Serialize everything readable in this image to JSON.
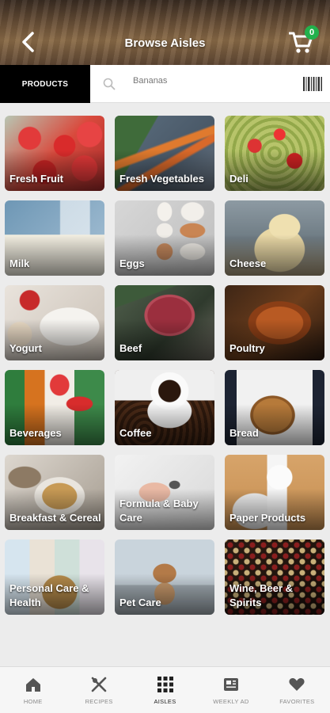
{
  "header": {
    "title": "Browse Aisles",
    "cart_count": "0"
  },
  "search": {
    "tab_label": "PRODUCTS",
    "placeholder": "Bananas"
  },
  "aisles": [
    {
      "label": "Fresh Fruit"
    },
    {
      "label": "Fresh Vegetables"
    },
    {
      "label": "Deli"
    },
    {
      "label": "Milk"
    },
    {
      "label": "Eggs"
    },
    {
      "label": "Cheese"
    },
    {
      "label": "Yogurt"
    },
    {
      "label": "Beef"
    },
    {
      "label": "Poultry"
    },
    {
      "label": "Beverages"
    },
    {
      "label": "Coffee"
    },
    {
      "label": "Bread"
    },
    {
      "label": "Breakfast & Cereal"
    },
    {
      "label": "Formula & Baby Care"
    },
    {
      "label": "Paper Products"
    },
    {
      "label": "Personal Care & Health"
    },
    {
      "label": "Pet Care"
    },
    {
      "label": "Wine, Beer & Spirits"
    }
  ],
  "nav": {
    "home": "HOME",
    "recipes": "RECIPES",
    "aisles": "AISLES",
    "weekly_ad": "WEEKLY AD",
    "favorites": "FAVORITES"
  },
  "colors": {
    "accent": "#22b14c",
    "tab_bg": "#000000",
    "active_nav": "#222222"
  }
}
